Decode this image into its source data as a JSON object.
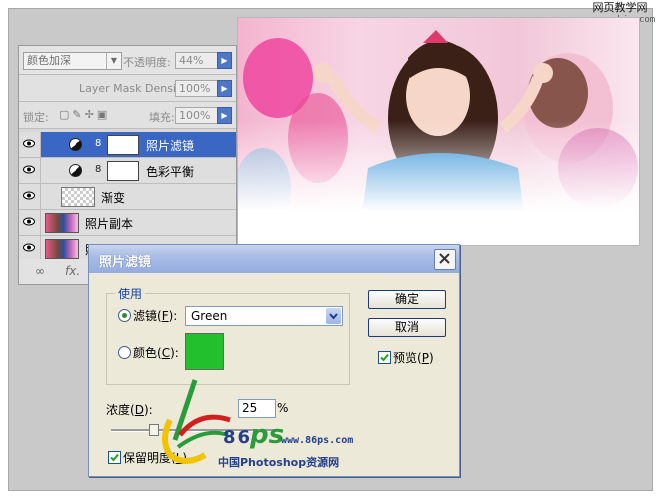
{
  "watermark_top": {
    "line1": "网页教学网",
    "line2": "www.webjx.com"
  },
  "layers_panel": {
    "blend_mode": "颜色加深",
    "opacity_label": "不透明度:",
    "opacity_value": "44%",
    "density_label": "Layer Mask Density",
    "density_value": "100%",
    "lock_label": "锁定:",
    "fill_label": "填充:",
    "fill_value": "100%",
    "layers": [
      {
        "name": "照片滤镜",
        "selected": true
      },
      {
        "name": "色彩平衡",
        "selected": false
      },
      {
        "name": "渐变",
        "selected": false
      },
      {
        "name": "照片副本",
        "selected": false
      },
      {
        "name": "照",
        "selected": false
      }
    ],
    "bottom_link": "∞",
    "bottom_fx": "fx."
  },
  "dialog": {
    "title": "照片滤镜",
    "group_label": "使用",
    "filter_label": "滤镜(",
    "filter_key": "F",
    "filter_end": "):",
    "filter_value": "Green",
    "color_label": "颜色(",
    "color_key": "C",
    "color_end": "):",
    "color_swatch": "#22c02c",
    "ok_label": "确定",
    "cancel_label": "取消",
    "preview_label": "预览(",
    "preview_key": "P",
    "preview_end": ")",
    "density_label": "浓度(",
    "density_key": "D",
    "density_end": "):",
    "density_value": "25",
    "density_unit": "%",
    "preserve_label": "保留明度(",
    "preserve_key": "L",
    "preserve_end": ")"
  },
  "logo": {
    "num": "86",
    "ps": "ps",
    "url": "www.86ps.com",
    "caption": "中国Photoshop资源网"
  }
}
